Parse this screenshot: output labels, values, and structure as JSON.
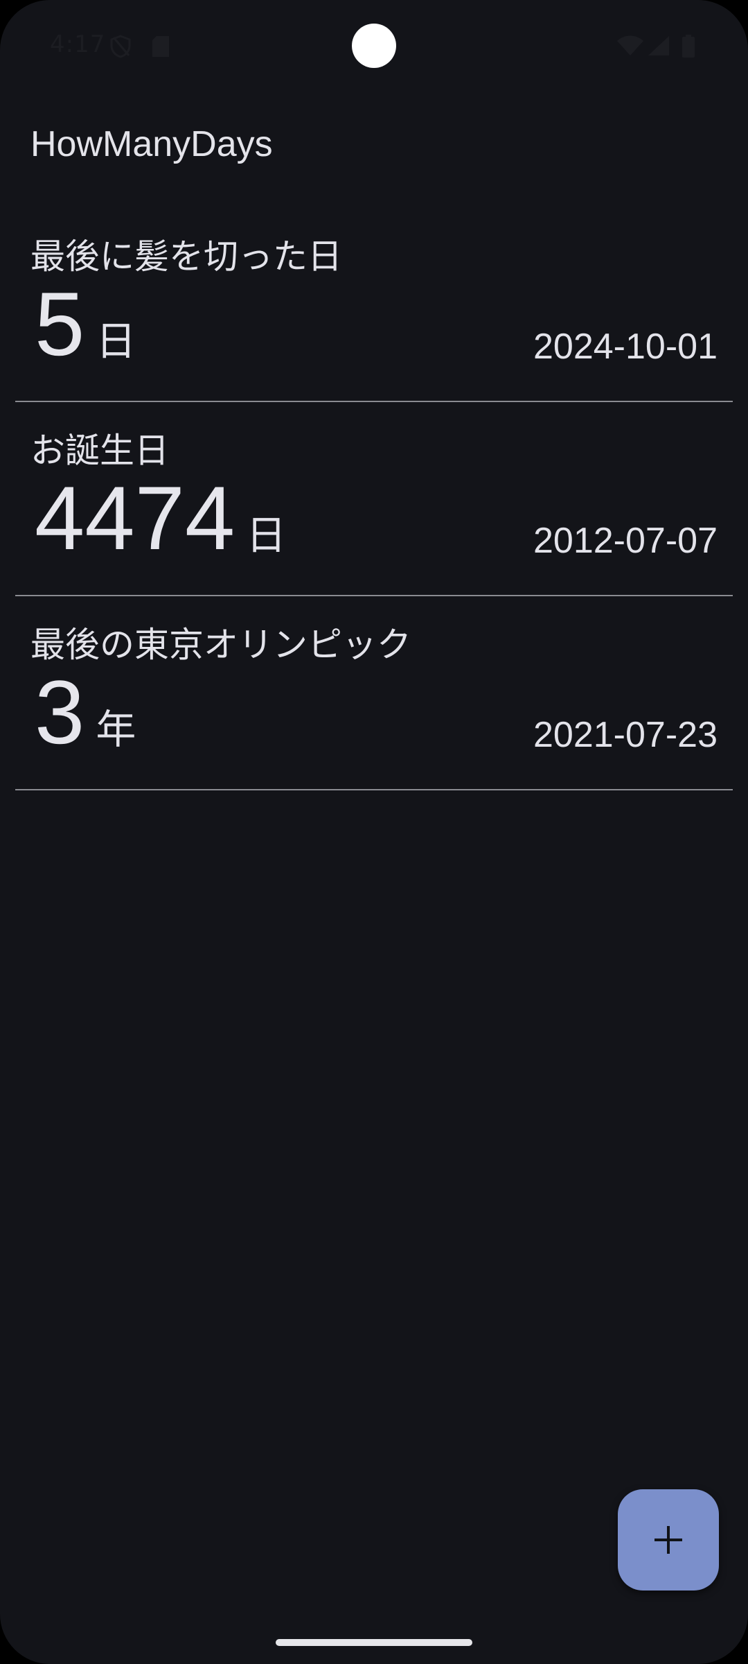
{
  "status_bar": {
    "time": "4:17"
  },
  "app": {
    "title": "HowManyDays"
  },
  "items": [
    {
      "title": "最後に髪を切った日",
      "count": "5",
      "unit": "日",
      "date": "2024-10-01"
    },
    {
      "title": "お誕生日",
      "count": "4474",
      "unit": "日",
      "date": "2012-07-07"
    },
    {
      "title": "最後の東京オリンピック",
      "count": "3",
      "unit": "年",
      "date": "2021-07-23"
    }
  ],
  "fab": {
    "icon": "plus-icon"
  },
  "colors": {
    "background": "#131419",
    "fab": "#7b8fcb",
    "divider": "#8a8b91",
    "text": "#e3e3ea"
  }
}
